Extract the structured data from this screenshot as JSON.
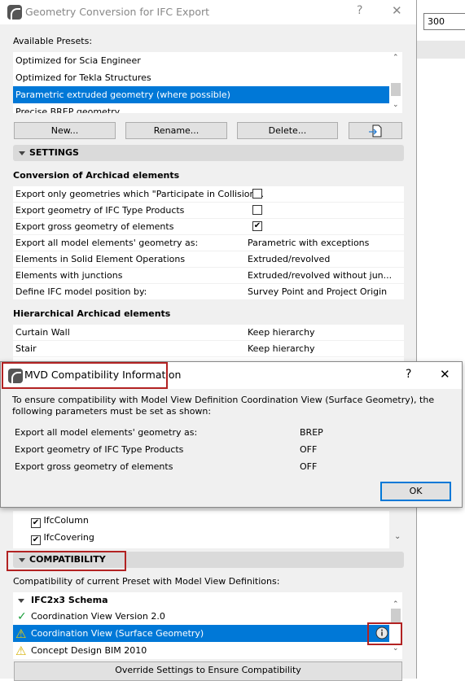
{
  "background": {
    "input_value": "300"
  },
  "main_dialog": {
    "title": "Geometry Conversion for IFC Export",
    "help": "?",
    "close": "✕",
    "presets_label": "Available Presets:",
    "presets": [
      "Optimized for Scia Engineer",
      "Optimized for Tekla Structures",
      "Parametric extruded geometry (where possible)",
      "Precise BREP geometry"
    ],
    "selected_preset": 2,
    "buttons": {
      "new": "New...",
      "rename": "Rename...",
      "delete": "Delete..."
    },
    "settings_label": "SETTINGS",
    "conversion_heading": "Conversion of Archicad elements",
    "conversion_rows": [
      {
        "label": "Export only geometries which \"Participate in Collision...",
        "checked": false
      },
      {
        "label": "Export geometry of IFC Type Products",
        "checked": false
      },
      {
        "label": "Export gross geometry of elements",
        "checked": true
      },
      {
        "label": "Export all model elements' geometry as:",
        "value": "Parametric with exceptions"
      },
      {
        "label": "Elements in Solid Element Operations",
        "value": "Extruded/revolved"
      },
      {
        "label": "Elements with junctions",
        "value": "Extruded/revolved without jun..."
      },
      {
        "label": "Define IFC model position by:",
        "value": "Survey Point and Project Origin"
      }
    ],
    "hierarchy_heading": "Hierarchical Archicad elements",
    "hierarchy_rows": [
      {
        "label": "Curtain Wall",
        "value": "Keep hierarchy"
      },
      {
        "label": "Stair",
        "value": "Keep hierarchy"
      }
    ],
    "ifc_items": [
      "IfcColumn",
      "IfcCovering"
    ],
    "compat_label": "COMPATIBILITY",
    "compat_desc": "Compatibility of current Preset with Model View Definitions:",
    "schema": "IFC2x3 Schema",
    "mvds": [
      {
        "label": "Coordination View Version 2.0",
        "status": "ok"
      },
      {
        "label": "Coordination View (Surface Geometry)",
        "status": "warning"
      },
      {
        "label": "Concept Design BIM 2010",
        "status": "warning"
      }
    ],
    "override_button": "Override Settings to Ensure Compatibility"
  },
  "mvd_dialog": {
    "title": "MVD Compatibility Information",
    "help": "?",
    "close": "✕",
    "message": "To ensure compatibility with Model View Definition Coordination View (Surface Geometry), the following parameters must be set as shown:",
    "rows": [
      {
        "label": "Export all model elements' geometry as:",
        "value": "BREP"
      },
      {
        "label": "Export geometry of IFC Type Products",
        "value": "OFF"
      },
      {
        "label": "Export gross geometry of elements",
        "value": "OFF"
      }
    ],
    "ok": "OK"
  },
  "colors": {
    "selection": "#0078d7",
    "highlight_box": "#b22222",
    "ok_check": "#1a9e3a",
    "warning": "#f5d200"
  }
}
